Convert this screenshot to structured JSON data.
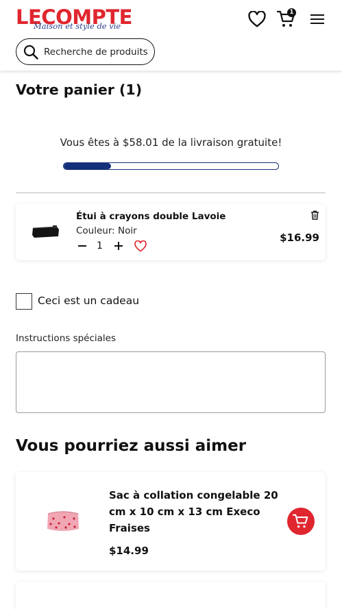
{
  "header": {
    "logo_text": "LECOMPTE",
    "logo_tagline": "Maison et style de vie",
    "cart_count": "1",
    "search_placeholder": "Recherche de produits"
  },
  "cart": {
    "title": "Votre panier (1)",
    "shipping_message": "Vous êtes à $58.01 de la livraison gratuite!",
    "shipping_progress": 0.22,
    "items": [
      {
        "name": "Étui à crayons double Lavoie",
        "variant": "Couleur: Noir",
        "quantity": "1",
        "price": "$16.99"
      }
    ],
    "gift_label": "Ceci est un cadeau",
    "instructions_label": "Instructions spéciales",
    "instructions_value": ""
  },
  "recommendations": {
    "title": "Vous pourriez aussi aimer",
    "items": [
      {
        "name": "Sac à collation congelable 20 cm x 10 cm x 13 cm Execo Fraises",
        "price": "$14.99"
      }
    ]
  },
  "colors": {
    "brand_red": "#e0262f",
    "brand_blue": "#15307a",
    "tagline_blue": "#2b3f8e"
  },
  "icons": [
    "heart-icon",
    "cart-icon",
    "menu-icon",
    "search-icon",
    "minus-icon",
    "plus-icon",
    "trash-icon",
    "add-to-cart-icon"
  ]
}
